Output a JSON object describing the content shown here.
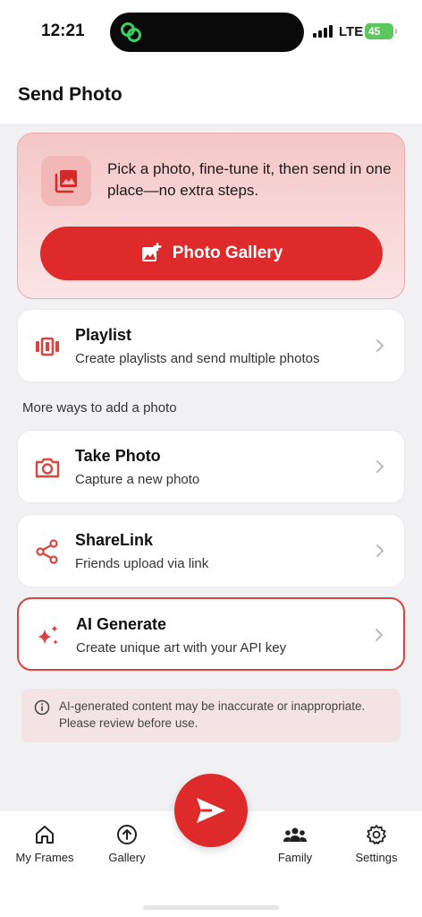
{
  "status_bar": {
    "time": "12:21",
    "network": "LTE",
    "battery": "45"
  },
  "header": {
    "title": "Send Photo"
  },
  "hero": {
    "text": "Pick a photo, fine-tune it, then send in one place—no extra steps.",
    "button_label": "Photo Gallery"
  },
  "playlist": {
    "title": "Playlist",
    "subtitle": "Create playlists and send multiple photos"
  },
  "section_label": "More ways to add a photo",
  "take_photo": {
    "title": "Take Photo",
    "subtitle": "Capture a new photo"
  },
  "sharelink": {
    "title": "ShareLink",
    "subtitle": "Friends upload via link"
  },
  "ai_generate": {
    "title": "AI Generate",
    "subtitle": "Create unique art with your API key"
  },
  "notice": {
    "text": "AI-generated content may be inaccurate or inappropriate. Please review before use."
  },
  "nav": {
    "items": [
      {
        "label": "My Frames",
        "icon": "home-icon"
      },
      {
        "label": "Gallery",
        "icon": "upload-circle-icon"
      },
      {
        "label": "Family",
        "icon": "family-icon"
      },
      {
        "label": "Settings",
        "icon": "gear-icon"
      }
    ],
    "fab_icon": "send-icon"
  },
  "colors": {
    "accent": "#de2a2a",
    "hero_bg": "#f4c7c7",
    "notice_bg": "#f3e3e5",
    "content_bg": "#f1f1f3",
    "battery": "#5ac85a"
  }
}
